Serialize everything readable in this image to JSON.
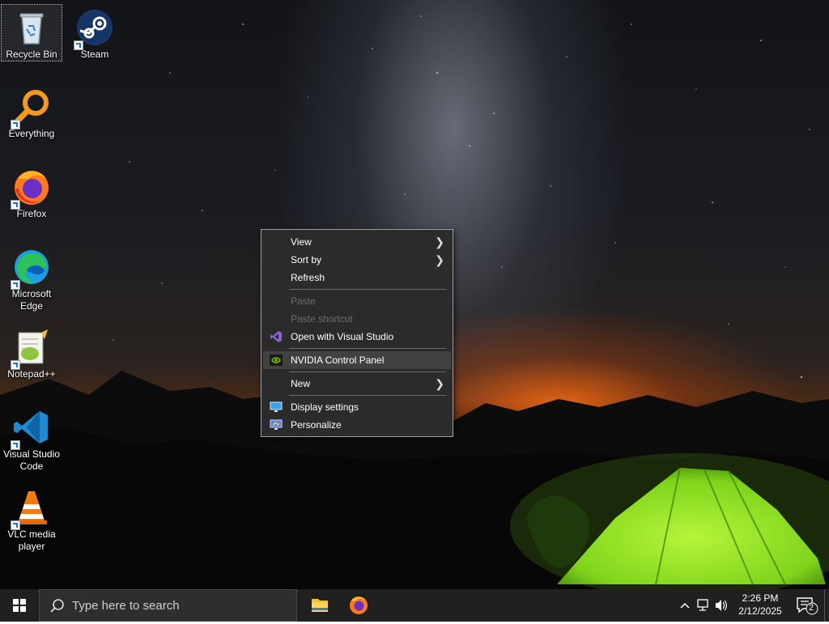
{
  "desktop_icons": [
    {
      "label": "Recycle Bin",
      "icon": "recycle-bin-icon",
      "selected": true
    },
    {
      "label": "Steam",
      "icon": "steam-icon"
    },
    {
      "label": "Everything",
      "icon": "everything-search-icon"
    },
    {
      "label": "Firefox",
      "icon": "firefox-icon"
    },
    {
      "label": "Microsoft Edge",
      "icon": "edge-icon"
    },
    {
      "label": "Notepad++",
      "icon": "notepad-plus-plus-icon"
    },
    {
      "label": "Visual Studio Code",
      "icon": "vscode-icon"
    },
    {
      "label": "VLC media player",
      "icon": "vlc-icon"
    }
  ],
  "context_menu": {
    "items": [
      {
        "label": "View",
        "submenu": true
      },
      {
        "label": "Sort by",
        "submenu": true
      },
      {
        "label": "Refresh"
      },
      {
        "label": "Paste",
        "disabled": true
      },
      {
        "label": "Paste shortcut",
        "disabled": true
      },
      {
        "label": "Open with Visual Studio",
        "icon": "visual-studio-icon"
      },
      {
        "label": "NVIDIA Control Panel",
        "icon": "nvidia-icon",
        "highlighted": true
      },
      {
        "label": "New",
        "submenu": true
      },
      {
        "label": "Display settings",
        "icon": "display-settings-icon"
      },
      {
        "label": "Personalize",
        "icon": "personalize-icon"
      }
    ]
  },
  "taskbar": {
    "search_placeholder": "Type here to search",
    "pinned": [
      {
        "name": "File Explorer",
        "icon": "file-explorer-icon"
      },
      {
        "name": "Firefox",
        "icon": "firefox-icon"
      }
    ],
    "clock": {
      "time": "2:26 PM",
      "date": "2/12/2025"
    },
    "notification_count": "2"
  },
  "colors": {
    "taskbar": "#202020",
    "menu_bg": "#2b2b2b",
    "menu_hover": "#414141",
    "tent_green": "#8ee02a"
  }
}
